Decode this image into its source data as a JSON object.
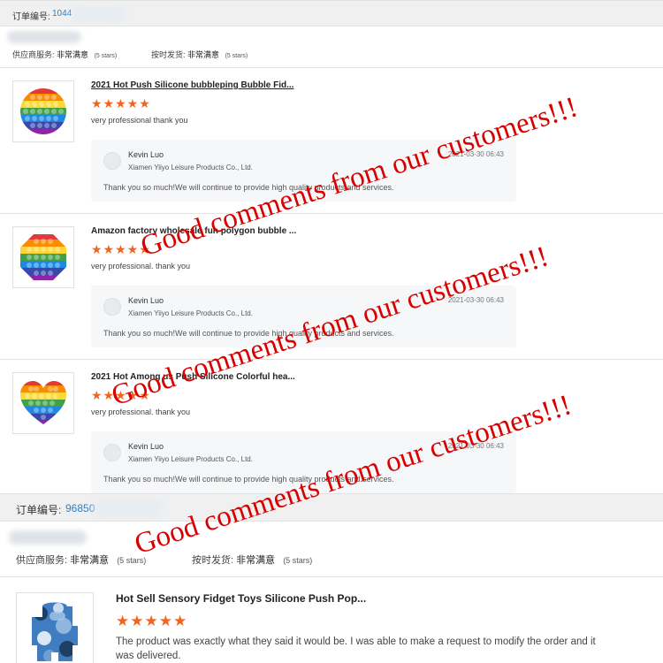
{
  "orders": [
    {
      "label": "订单编号:",
      "number": "1044",
      "supplier_service_label": "供应商服务:",
      "supplier_service_value": "非常满意",
      "supplier_service_stars": "(5 stars)",
      "delivery_label": "按时发货:",
      "delivery_value": "非常满意",
      "delivery_stars": "(5 stars)"
    },
    {
      "label": "订单编号:",
      "number": "96850",
      "supplier_service_label": "供应商服务:",
      "supplier_service_value": "非常满意",
      "supplier_service_stars": "(5 stars)",
      "delivery_label": "按时发货:",
      "delivery_value": "非常满意",
      "delivery_stars": "(5 stars)"
    }
  ],
  "reviews": [
    {
      "title": "2021 Hot Push Silicone bubbleping Bubble Fid...",
      "stars": "★★★★★",
      "comment": "very professional thank you",
      "reply_name": "Kevin Luo",
      "reply_company": "Xiamen Yiiyo Leisure Products Co., Ltd.",
      "reply_date": "2021-03-30 06:43",
      "reply_text": "Thank you so much!We will continue to provide high quality products and services."
    },
    {
      "title": "Amazon factory wholesale fun polygon bubble ...",
      "stars": "★★★★★",
      "comment": "very professional. thank you",
      "reply_name": "Kevin Luo",
      "reply_company": "Xiamen Yiiyo Leisure Products Co., Ltd.",
      "reply_date": "2021-03-30 06:43",
      "reply_text": "Thank you so much!We will continue to provide high quality products and services."
    },
    {
      "title": "2021 Hot Among us Push Silicone Colorful hea...",
      "stars": "★★★★★",
      "comment": "very professional. thank you",
      "reply_name": "Kevin Luo",
      "reply_company": "Xiamen Yiiyo Leisure Products Co., Ltd.",
      "reply_date": "2021-03-30 06:43",
      "reply_text": "Thank you so much!We will continue to provide high quality products and services."
    },
    {
      "title": "Hot Sell Sensory Fidget Toys Silicone Push Pop...",
      "stars": "★★★★★",
      "comment_line1": "The product was exactly what they said it would be. I was able to make a request to modify the order and it",
      "comment_line2": "was delivered."
    }
  ],
  "overlay_text": "Good comments from our customers!!!",
  "colors": {
    "star": "#f2641e",
    "overlay": "#d90000",
    "order_number": "#2d7fc6"
  },
  "icons": {
    "thumb1": "round-rainbow-pop-it-icon",
    "thumb2": "octagon-rainbow-pop-it-icon",
    "thumb3": "heart-rainbow-pop-it-icon",
    "thumb4": "camo-astronaut-pop-it-icon"
  }
}
